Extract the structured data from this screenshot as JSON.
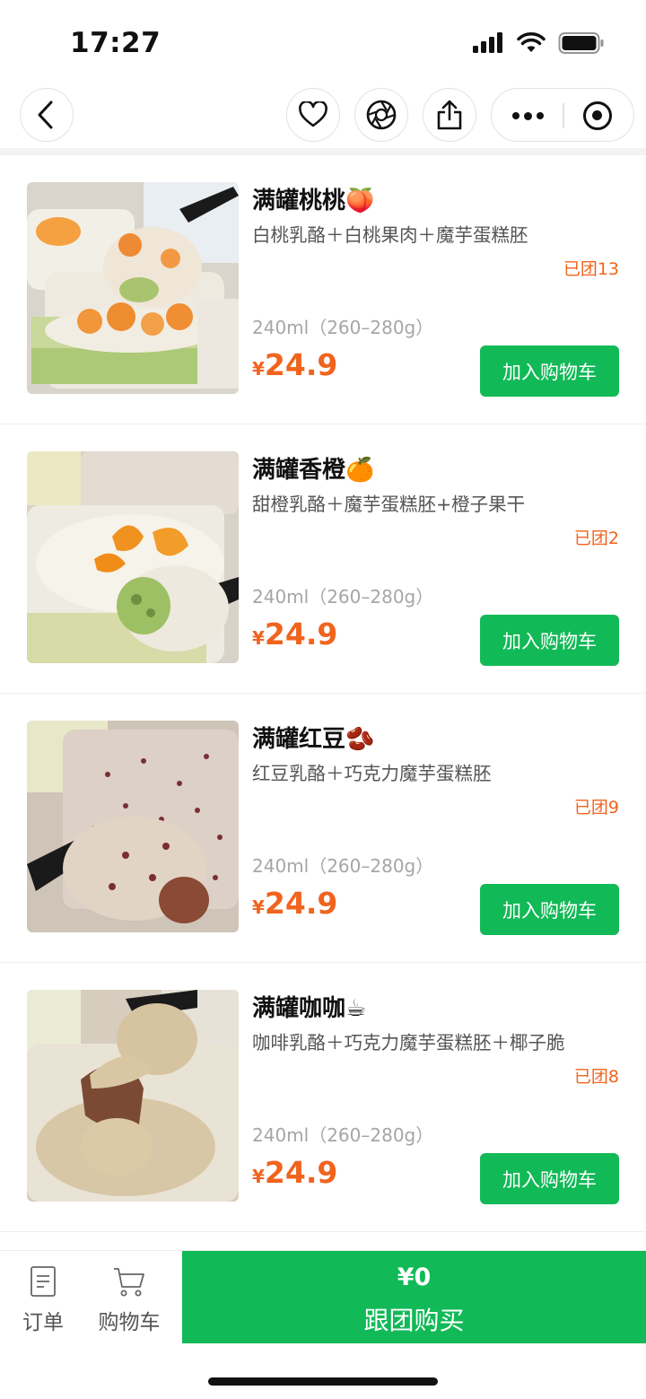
{
  "status_bar": {
    "time": "17:27"
  },
  "nav": {
    "back_icon": "chevron-left-icon",
    "favorite_icon": "heart-icon",
    "share_moments_icon": "aperture-icon",
    "share_icon": "share-icon",
    "more_icon": "more-dots-icon",
    "close_icon": "target-icon"
  },
  "products": [
    {
      "name": "满罐桃桃🍑",
      "desc": "白桃乳酪＋白桃果肉＋魔芋蛋糕胚",
      "sold": "已团13",
      "spec": "240ml（260–280g）",
      "currency": "¥",
      "price": "24.9",
      "button": "加入购物车"
    },
    {
      "name": "满罐香橙🍊",
      "desc": "甜橙乳酪＋魔芋蛋糕胚+橙子果干",
      "sold": "已团2",
      "spec": "240ml（260–280g）",
      "currency": "¥",
      "price": "24.9",
      "button": "加入购物车"
    },
    {
      "name": "满罐红豆🫘",
      "desc": "红豆乳酪＋巧克力魔芋蛋糕胚",
      "sold": "已团9",
      "spec": "240ml（260–280g）",
      "currency": "¥",
      "price": "24.9",
      "button": "加入购物车"
    },
    {
      "name": "满罐咖咖☕",
      "desc": "咖啡乳酪＋巧克力魔芋蛋糕胚＋椰子脆",
      "sold": "已团8",
      "spec": "240ml（260–280g）",
      "currency": "¥",
      "price": "24.9",
      "button": "加入购物车"
    }
  ],
  "bottom_bar": {
    "orders_label": "订单",
    "cart_label": "购物车",
    "total": "¥0",
    "buy_label": "跟团购买"
  },
  "colors": {
    "accent_green": "#12b957",
    "price_orange": "#f0641e"
  }
}
